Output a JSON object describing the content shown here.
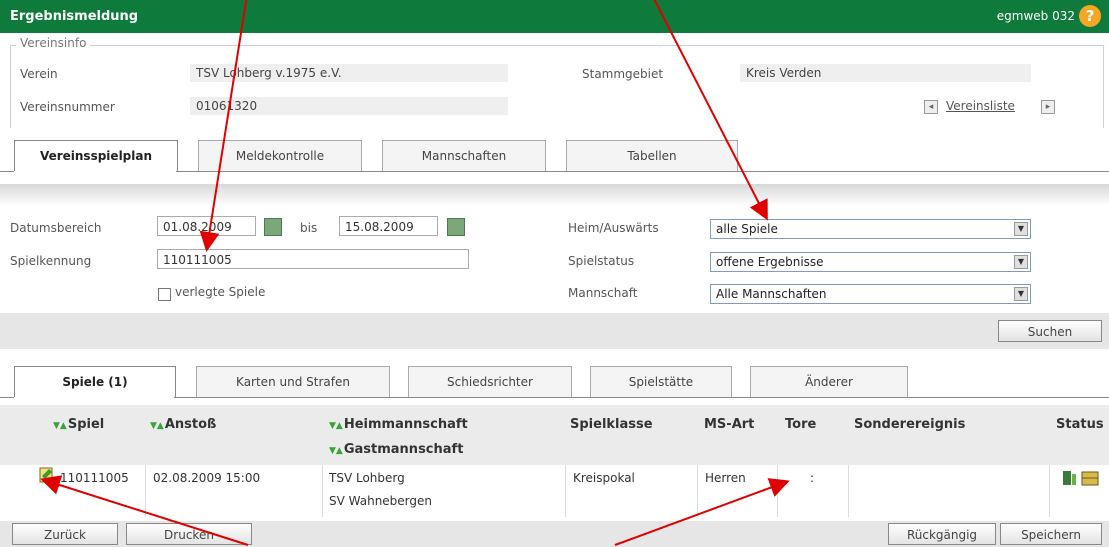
{
  "header": {
    "title": "Ergebnismeldung",
    "code": "egmweb 032",
    "help": "?"
  },
  "vereinsinfo": {
    "legend": "Vereinsinfo",
    "verein_label": "Verein",
    "verein_value": "TSV Lohberg v.1975 e.V.",
    "nummer_label": "Vereinsnummer",
    "nummer_value": "01061320",
    "gebiet_label": "Stammgebiet",
    "gebiet_value": "Kreis Verden",
    "vereinsliste": "Vereinsliste"
  },
  "main_tabs": [
    "Vereinsspielplan",
    "Meldekontrolle",
    "Mannschaften",
    "Tabellen"
  ],
  "filter": {
    "datum_label": "Datumsbereich",
    "datum_from": "01.08.2009",
    "bis_label": "bis",
    "datum_to": "15.08.2009",
    "spielkennung_label": "Spielkennung",
    "spielkennung_value": "110111005",
    "verlegte_label": "verlegte Spiele",
    "heim_label": "Heim/Auswärts",
    "heim_value": "alle Spiele",
    "status_label": "Spielstatus",
    "status_value": "offene Ergebnisse",
    "mannschaft_label": "Mannschaft",
    "mannschaft_value": "Alle Mannschaften",
    "suchen": "Suchen"
  },
  "sub_tabs": [
    "Spiele (1)",
    "Karten und Strafen",
    "Schiedsrichter",
    "Spielstätte",
    "Änderer"
  ],
  "table": {
    "columns": {
      "spiel": "Spiel",
      "anstoss": "Anstoß",
      "heim": "Heimmannschaft",
      "gast": "Gastmannschaft",
      "spielklasse": "Spielklasse",
      "msart": "MS-Art",
      "tore": "Tore",
      "sonder": "Sonderereignis",
      "status": "Status"
    },
    "sort_glyph": "▼▲",
    "row": {
      "spiel": "110111005",
      "anstoss": "02.08.2009 15:00",
      "heim": "TSV Lohberg",
      "gast": "SV Wahnebergen",
      "spielklasse": "Kreispokal",
      "msart": "Herren",
      "tore": ":"
    }
  },
  "buttons": {
    "zurueck": "Zurück",
    "drucken": "Drucken",
    "rueckgaengig": "Rückgängig",
    "speichern": "Speichern"
  },
  "colors": {
    "header_green": "#0e7a3c",
    "arrow_red": "#e00000",
    "help_orange": "#f5a623"
  }
}
